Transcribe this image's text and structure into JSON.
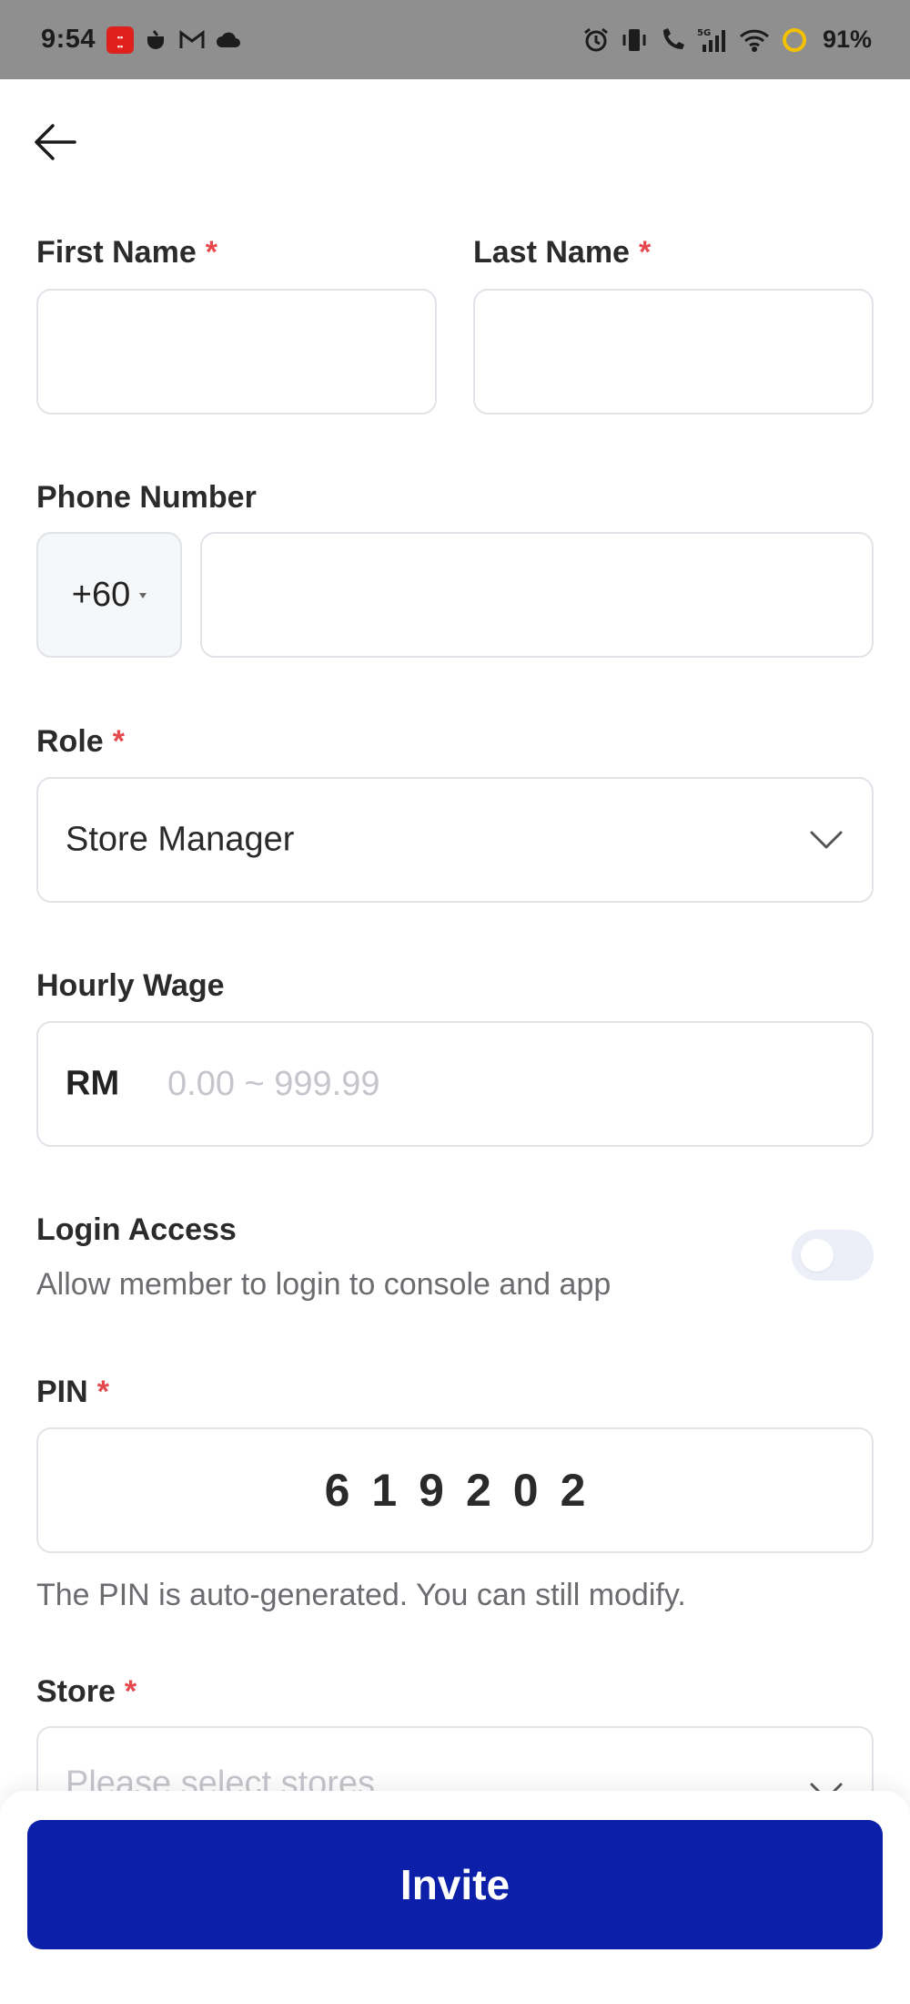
{
  "status_bar": {
    "time": "9:54",
    "battery_percent": "91%",
    "icons_left": [
      "app-notification-icon",
      "cup-icon",
      "gmail-icon",
      "cloud-icon"
    ],
    "icons_right": [
      "alarm-icon",
      "vibrate-icon",
      "wifi-calling-icon",
      "signal-5g-icon",
      "wifi-icon",
      "battery-icon"
    ]
  },
  "form": {
    "first_name": {
      "label": "First Name",
      "required_mark": "*",
      "value": ""
    },
    "last_name": {
      "label": "Last Name",
      "required_mark": "*",
      "value": ""
    },
    "phone": {
      "label": "Phone Number",
      "country_code": "+60",
      "value": ""
    },
    "role": {
      "label": "Role",
      "required_mark": "*",
      "selected": "Store Manager"
    },
    "hourly_wage": {
      "label": "Hourly Wage",
      "currency": "RM",
      "placeholder": "0.00 ~ 999.99",
      "value": ""
    },
    "login_access": {
      "label": "Login Access",
      "description": "Allow member to login to console and app",
      "enabled": false
    },
    "pin": {
      "label": "PIN",
      "required_mark": "*",
      "value": "619202",
      "hint": "The PIN is auto-generated. You can still modify."
    },
    "store": {
      "label": "Store",
      "required_mark": "*",
      "placeholder": "Please select stores"
    }
  },
  "actions": {
    "invite_label": "Invite"
  },
  "colors": {
    "primary": "#0b1fa9",
    "required": "#e5484d",
    "status_bar": "#8f8f8f"
  }
}
